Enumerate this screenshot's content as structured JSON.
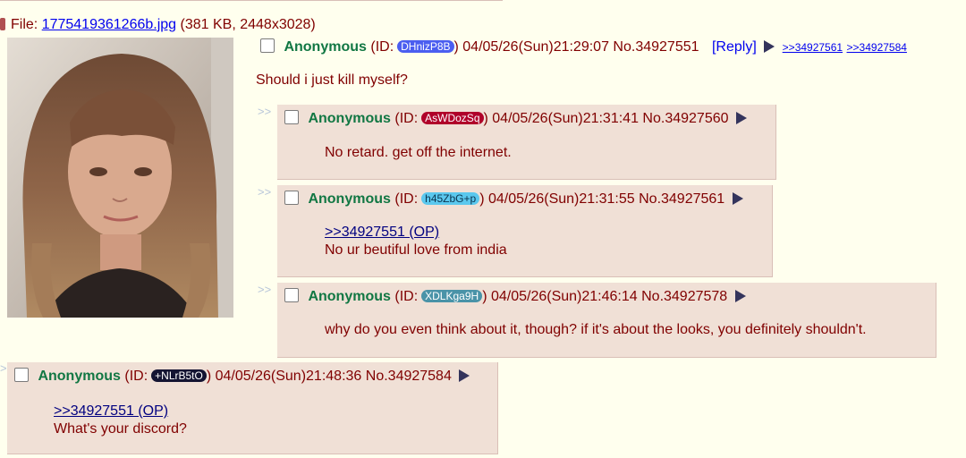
{
  "op": {
    "file_label": "File:",
    "file_name": "1775419361266b.jpg",
    "file_meta": "(381 KB, 2448x3028)",
    "name": "Anonymous",
    "id_prefix": "(ID:",
    "id": "DHnizP8B",
    "id_suffix": ")",
    "datetime": "04/05/26(Sun)21:29:07",
    "number": "No.34927551",
    "reply_label": "[Reply]",
    "backlinks": [
      ">>34927561",
      ">>34927584"
    ],
    "comment": "Should i just kill myself?"
  },
  "replies": [
    {
      "side": ">>",
      "name": "Anonymous",
      "id_prefix": "(ID:",
      "id": "AsWDozSq",
      "id_color": "#b0002a",
      "id_suffix": ")",
      "datetime": "04/05/26(Sun)21:31:41",
      "number": "No.34927560",
      "quote": "",
      "comment": "No retard. get off the internet."
    },
    {
      "side": ">>",
      "name": "Anonymous",
      "id_prefix": "(ID:",
      "id": "h45ZbG+p",
      "id_color": "#5bc8ee",
      "id_suffix": ")",
      "datetime": "04/05/26(Sun)21:31:55",
      "number": "No.34927561",
      "quote": ">>34927551 (OP)",
      "comment": "No ur beutiful love from india"
    },
    {
      "side": ">>",
      "name": "Anonymous",
      "id_prefix": "(ID:",
      "id": "XDLKga9H",
      "id_color": "#4a93a8",
      "id_suffix": ")",
      "datetime": "04/05/26(Sun)21:46:14",
      "number": "No.34927578",
      "quote": "",
      "comment": "why do you even think about it, though? if it's about the looks, you definitely shouldn't."
    },
    {
      "side": ">",
      "name": "Anonymous",
      "id_prefix": "(ID:",
      "id": "+NLrB5tO",
      "id_color": "#141432",
      "id_suffix": ")",
      "datetime": "04/05/26(Sun)21:48:36",
      "number": "No.34927584",
      "quote": ">>34927551 (OP)",
      "comment": "What's your discord?"
    }
  ],
  "colors": {
    "background": "#ffffee",
    "reply_bg": "#f0e0d6",
    "name": "#117743",
    "text": "#800000",
    "op_id": "#4b5ef0"
  }
}
